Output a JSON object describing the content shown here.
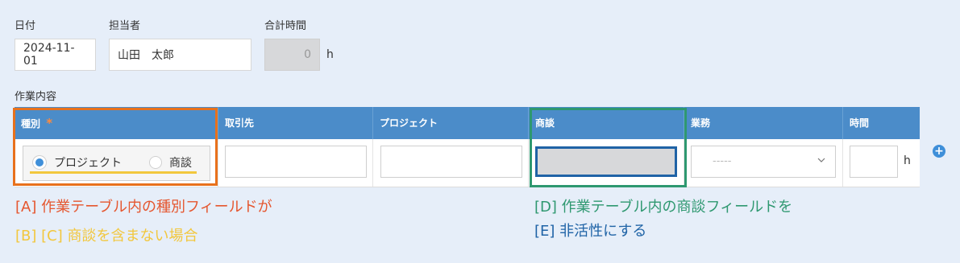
{
  "form": {
    "date_label": "日付",
    "date_value": "2024-11-01",
    "person_label": "担当者",
    "person_value": "山田　太郎",
    "total_label": "合計時間",
    "total_value": "0",
    "total_unit": "h",
    "section_label": "作業内容"
  },
  "table": {
    "headers": {
      "type": "種別",
      "required_mark": "*",
      "client": "取引先",
      "project": "プロジェクト",
      "deal": "商談",
      "task": "業務",
      "hours": "時間"
    },
    "row": {
      "radio_options": [
        "プロジェクト",
        "商談"
      ],
      "selected_option": "プロジェクト",
      "task_select_value": "-----",
      "hours_unit": "h"
    },
    "add_row_icon": "plus-circle-icon"
  },
  "annotations": {
    "a": "[A] 作業テーブル内の種別フィールドが",
    "bc": "[B] [C] 商談を含まない場合",
    "d": "[D] 作業テーブル内の商談フィールドを",
    "e": "[E] 非活性にする"
  },
  "colors": {
    "orange": "#e8711c",
    "yellow": "#f2c73d",
    "green": "#2e9870",
    "blue": "#1f63a6",
    "red_text": "#e5562f",
    "header_blue": "#4b8cc9"
  }
}
